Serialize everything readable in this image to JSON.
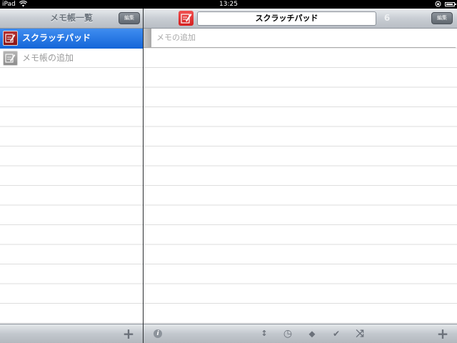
{
  "status_bar": {
    "carrier": "iPad",
    "wifi_icon": "wifi-icon",
    "time": "13:25",
    "rotation_lock_icon": "rotation-lock-icon",
    "battery_level": 0.9
  },
  "sidebar": {
    "title": "メモ帳一覧",
    "edit_label": "編集",
    "items": [
      {
        "label": "スクラッチパッド",
        "icon": "memo-pad-icon",
        "selected": true
      },
      {
        "label": "メモ帳の追加",
        "icon": "memo-pad-icon",
        "selected": false
      }
    ],
    "toolbar": {
      "add_label": "+"
    }
  },
  "detail": {
    "title": "スクラッチパッド",
    "count": "6",
    "edit_label": "編集",
    "add_memo_placeholder": "メモの追加",
    "toolbar": {
      "info_label": "i",
      "sort_label": "↕",
      "clock_label": "◷",
      "tag_label": "⬥",
      "check_label": "✔",
      "shuffle_label": "⤨",
      "add_label": "+"
    }
  },
  "colors": {
    "selection_blue": "#1f6fe0",
    "memo_icon_red": "#d9302f",
    "nav_gray": "#c9ced4"
  }
}
